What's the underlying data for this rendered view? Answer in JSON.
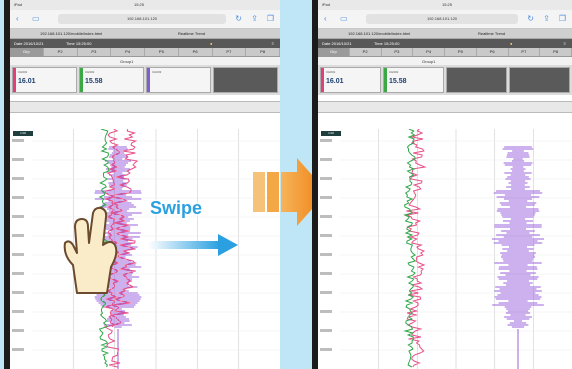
{
  "device": {
    "status_left": "iPad",
    "status_time": "15:25"
  },
  "browser": {
    "url": "192.168.101.120",
    "tab_left": "192.168.101.120/mobile/index.html",
    "tab_right": "Realtime Trend"
  },
  "app": {
    "date_label": "Date 2016/10/21",
    "time_label": "Time 15:25:00",
    "pages": [
      "Grp",
      "P2",
      "P3",
      "P4",
      "P5",
      "P6",
      "P7",
      "P8"
    ],
    "active_page": 0,
    "group_name": "Group1",
    "range_flag": "1:00"
  },
  "digital_values": [
    {
      "tag": "CH001",
      "value": "16.01",
      "color": "#e0407a"
    },
    {
      "tag": "CH002",
      "value": "15.58",
      "color": "#39a845"
    },
    {
      "tag": "CH003",
      "value": "",
      "color": "#7f5fd0"
    },
    {
      "tag": "",
      "value": "",
      "color": ""
    }
  ],
  "gesture": {
    "label": "Swipe",
    "label_color": "#2aa0e0"
  },
  "transition_arrow_color": "#f08a1e",
  "trend_colors": {
    "pink": "#e8508a",
    "green": "#2fa84a",
    "purple": "#9b63dc",
    "grid": "#d4d4d4"
  }
}
